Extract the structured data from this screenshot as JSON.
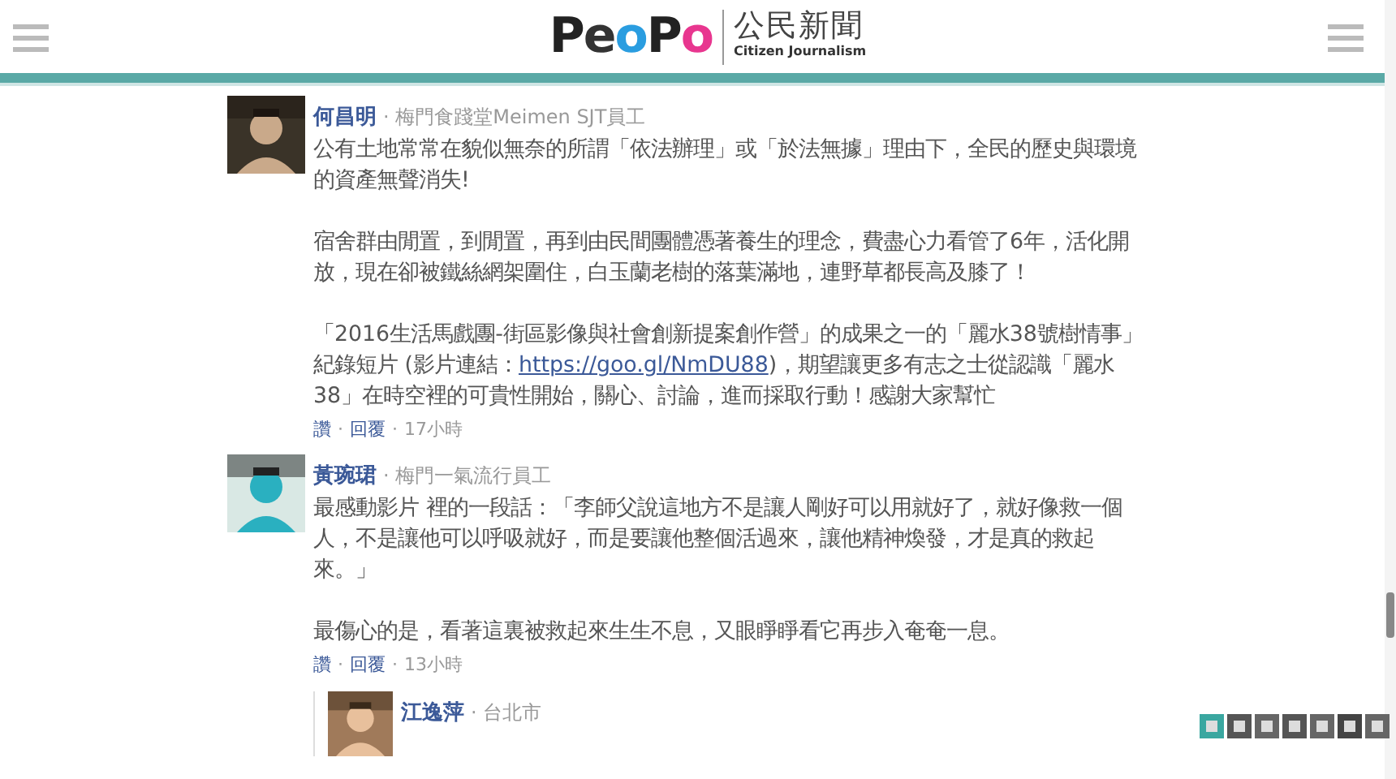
{
  "header": {
    "logo": "PeoPo",
    "logo_title": "公民新聞",
    "logo_subtitle": "Citizen Journalism"
  },
  "comments": [
    {
      "name": "何昌明",
      "meta": "· 梅門食踐堂Meimen SJT員工",
      "paragraphs": [
        "公有土地常常在貌似無奈的所謂「依法辦理」或「於法無據」理由下，全民的歷史與環境的資產無聲消失!",
        "宿舍群由閒置，到閒置，再到由民間團體憑著養生的理念，費盡心力看管了6年，活化開放，現在卻被鐵絲網架圍住，白玉蘭老樹的落葉滿地，連野草都長高及膝了！",
        {
          "before": "「2016生活馬戲團-街區影像與社會創新提案創作營」的成果之一的「麗水38號樹情事」紀錄短片 (影片連結：",
          "link": "https://goo.gl/NmDU88",
          "after": ")，期望讓更多有志之士從認識「麗水38」在時空裡的可貴性開始，關心、討論，進而採取行動！感謝大家幫忙"
        }
      ],
      "actions": [
        {
          "kind": "like",
          "text": "讚"
        },
        {
          "kind": "separator",
          "text": "·"
        },
        {
          "kind": "reply",
          "text": "回覆"
        },
        {
          "kind": "separator",
          "text": "·"
        },
        {
          "kind": "time",
          "text": "17小時"
        }
      ]
    },
    {
      "name": "黃琬珺",
      "meta": "· 梅門一氣流行員工",
      "paragraphs": [
        "最感動影片 裡的一段話：「李師父說這地方不是讓人剛好可以用就好了，就好像救一個人，不是讓他可以呼吸就好，而是要讓他整個活過來，讓他精神煥發，才是真的救起來。」",
        "最傷心的是，看著這裏被救起來生生不息，又眼睜睜看它再步入奄奄一息。"
      ],
      "actions": [
        {
          "kind": "like",
          "text": "讚"
        },
        {
          "kind": "separator",
          "text": "·"
        },
        {
          "kind": "reply",
          "text": "回覆"
        },
        {
          "kind": "separator",
          "text": "·"
        },
        {
          "kind": "time",
          "text": "13小時"
        }
      ],
      "replies": [
        {
          "name": "江逸萍",
          "meta": "· 台北市"
        }
      ]
    }
  ]
}
